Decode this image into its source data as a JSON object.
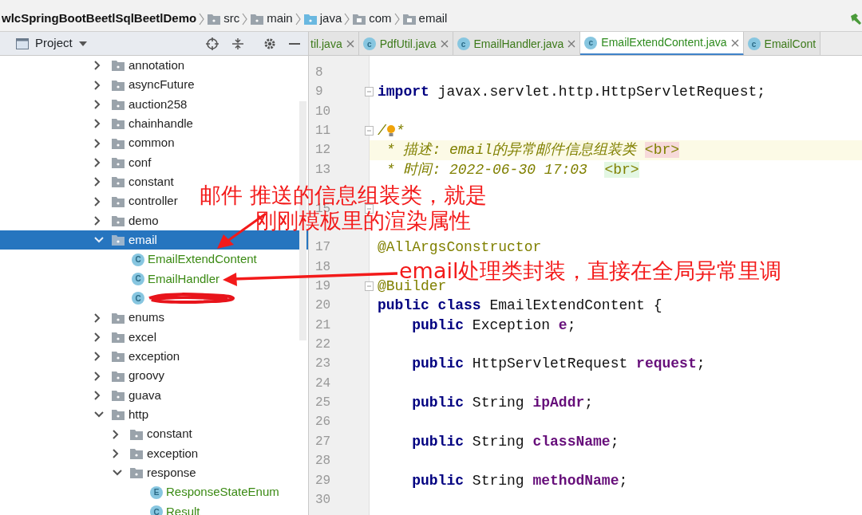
{
  "breadcrumb": [
    {
      "label": "wlcSpringBootBeetlSqlBeetlDemo",
      "kind": "module"
    },
    {
      "label": "src",
      "kind": "folder"
    },
    {
      "label": "main",
      "kind": "folder"
    },
    {
      "label": "java",
      "kind": "source"
    },
    {
      "label": "com",
      "kind": "package"
    },
    {
      "label": "email",
      "kind": "package"
    }
  ],
  "project_panel": {
    "title": "Project"
  },
  "tree": [
    {
      "label": "annotation",
      "kind": "folder",
      "expanded": false,
      "selected": false
    },
    {
      "label": "asyncFuture",
      "kind": "folder",
      "expanded": false,
      "selected": false
    },
    {
      "label": "auction258",
      "kind": "folder",
      "expanded": false,
      "selected": false
    },
    {
      "label": "chainhandle",
      "kind": "folder",
      "expanded": false,
      "selected": false
    },
    {
      "label": "common",
      "kind": "folder",
      "expanded": false,
      "selected": false
    },
    {
      "label": "conf",
      "kind": "folder",
      "expanded": false,
      "selected": false
    },
    {
      "label": "constant",
      "kind": "folder",
      "expanded": false,
      "selected": false
    },
    {
      "label": "controller",
      "kind": "folder",
      "expanded": false,
      "selected": false
    },
    {
      "label": "demo",
      "kind": "folder",
      "expanded": false,
      "selected": false
    },
    {
      "label": "email",
      "kind": "folder",
      "expanded": true,
      "selected": true,
      "children": [
        {
          "label": "EmailExtendContent",
          "kind": "file",
          "badge": "C",
          "selected": false
        },
        {
          "label": "EmailHandler",
          "kind": "file",
          "badge": "C",
          "selected": false
        },
        {
          "kind": "redacted",
          "badge": "C",
          "selected": false
        }
      ]
    },
    {
      "label": "enums",
      "kind": "folder",
      "expanded": false,
      "selected": false
    },
    {
      "label": "excel",
      "kind": "folder",
      "expanded": false,
      "selected": false
    },
    {
      "label": "exception",
      "kind": "folder",
      "expanded": false,
      "selected": false
    },
    {
      "label": "groovy",
      "kind": "folder",
      "expanded": false,
      "selected": false
    },
    {
      "label": "guava",
      "kind": "folder",
      "expanded": false,
      "selected": false
    },
    {
      "label": "http",
      "kind": "folder",
      "expanded": true,
      "selected": false,
      "children": [
        {
          "label": "constant",
          "kind": "folder",
          "expanded": false,
          "selected": false
        },
        {
          "label": "exception",
          "kind": "folder",
          "expanded": false,
          "selected": false
        },
        {
          "label": "response",
          "kind": "folder",
          "expanded": true,
          "selected": false,
          "children": [
            {
              "label": "ResponseStateEnum",
              "kind": "file",
              "badge": "E",
              "selected": false
            },
            {
              "label": "Result",
              "kind": "file",
              "badge": "C",
              "selected": false
            }
          ]
        }
      ]
    }
  ],
  "tabs": [
    {
      "label": "til.java",
      "selected": false,
      "closable": true
    },
    {
      "label": "PdfUtil.java",
      "badge": "c",
      "selected": false,
      "closable": true
    },
    {
      "label": "EmailHandler.java",
      "badge": "c",
      "selected": false,
      "closable": true
    },
    {
      "label": "EmailExtendContent.java",
      "badge": "c",
      "selected": true,
      "closable": true
    },
    {
      "label": "EmailCont",
      "badge": "c",
      "selected": false,
      "closable": false
    }
  ],
  "code_lines": [
    {
      "kind": "code",
      "number": "8"
    },
    {
      "kind": "code",
      "number": "9",
      "fold": true,
      "tokens": [
        {
          "kind": "keyword",
          "text": "import"
        },
        {
          "kind": "plain",
          "text": " javax.servlet.http.HttpServletRequest;"
        }
      ]
    },
    {
      "kind": "code",
      "number": "10"
    },
    {
      "kind": "code",
      "number": "11",
      "fold": true,
      "tokens": [
        {
          "kind": "doc",
          "text": "/"
        },
        {
          "kind": "bulb"
        },
        {
          "kind": "doc",
          "text": "*"
        }
      ]
    },
    {
      "kind": "code",
      "number": "12",
      "current": true,
      "tokens": [
        {
          "kind": "doc",
          "text": " * 描述: email的异常邮件信息组装类 "
        },
        {
          "kind": "tag-error",
          "text": "<br>"
        }
      ]
    },
    {
      "kind": "code",
      "number": "13",
      "tokens": [
        {
          "kind": "doc",
          "text": " * 时间: 2022-06-30 17:03  "
        },
        {
          "kind": "tag-match",
          "text": "<br>"
        }
      ]
    },
    {
      "kind": "covered"
    },
    {
      "kind": "code",
      "number": "15",
      "fold": true
    },
    {
      "kind": "covered"
    },
    {
      "kind": "code",
      "number": "17",
      "tokens": [
        {
          "kind": "annotation",
          "text": "@AllArgsConstructor"
        }
      ]
    },
    {
      "kind": "code",
      "number": "18"
    },
    {
      "kind": "code",
      "number": "19",
      "fold": true,
      "tokens": [
        {
          "kind": "annotation",
          "text": "@Builder"
        }
      ]
    },
    {
      "kind": "code",
      "number": "20",
      "tokens": [
        {
          "kind": "keyword",
          "text": "public class"
        },
        {
          "kind": "plain",
          "text": " EmailExtendContent {"
        }
      ]
    },
    {
      "kind": "code",
      "number": "21",
      "tokens": [
        {
          "kind": "keyword",
          "text": "    public"
        },
        {
          "kind": "plain",
          "text": " Exception "
        },
        {
          "kind": "field",
          "text": "e"
        },
        {
          "kind": "plain",
          "text": ";"
        }
      ]
    },
    {
      "kind": "code",
      "number": "22"
    },
    {
      "kind": "code",
      "number": "23",
      "tokens": [
        {
          "kind": "keyword",
          "text": "    public"
        },
        {
          "kind": "plain",
          "text": " HttpServletRequest "
        },
        {
          "kind": "field",
          "text": "request"
        },
        {
          "kind": "plain",
          "text": ";"
        }
      ]
    },
    {
      "kind": "code",
      "number": "24"
    },
    {
      "kind": "code",
      "number": "25",
      "tokens": [
        {
          "kind": "keyword",
          "text": "    public"
        },
        {
          "kind": "plain",
          "text": " String "
        },
        {
          "kind": "field",
          "text": "ipAddr"
        },
        {
          "kind": "plain",
          "text": ";"
        }
      ]
    },
    {
      "kind": "code",
      "number": "26"
    },
    {
      "kind": "code",
      "number": "27",
      "tokens": [
        {
          "kind": "keyword",
          "text": "    public"
        },
        {
          "kind": "plain",
          "text": " String "
        },
        {
          "kind": "field",
          "text": "className"
        },
        {
          "kind": "plain",
          "text": ";"
        }
      ]
    },
    {
      "kind": "code",
      "number": "28"
    },
    {
      "kind": "code",
      "number": "29",
      "tokens": [
        {
          "kind": "keyword",
          "text": "    public"
        },
        {
          "kind": "plain",
          "text": " String "
        },
        {
          "kind": "field",
          "text": "methodName"
        },
        {
          "kind": "plain",
          "text": ";"
        }
      ]
    },
    {
      "kind": "code",
      "number": "30"
    }
  ],
  "annotations": [
    {
      "text": "邮件 推送的信息组装类，就是"
    },
    {
      "text": "刚刚模板里的渲染属性"
    },
    {
      "text": "email处理类封装，直接在全局异常里调"
    }
  ]
}
